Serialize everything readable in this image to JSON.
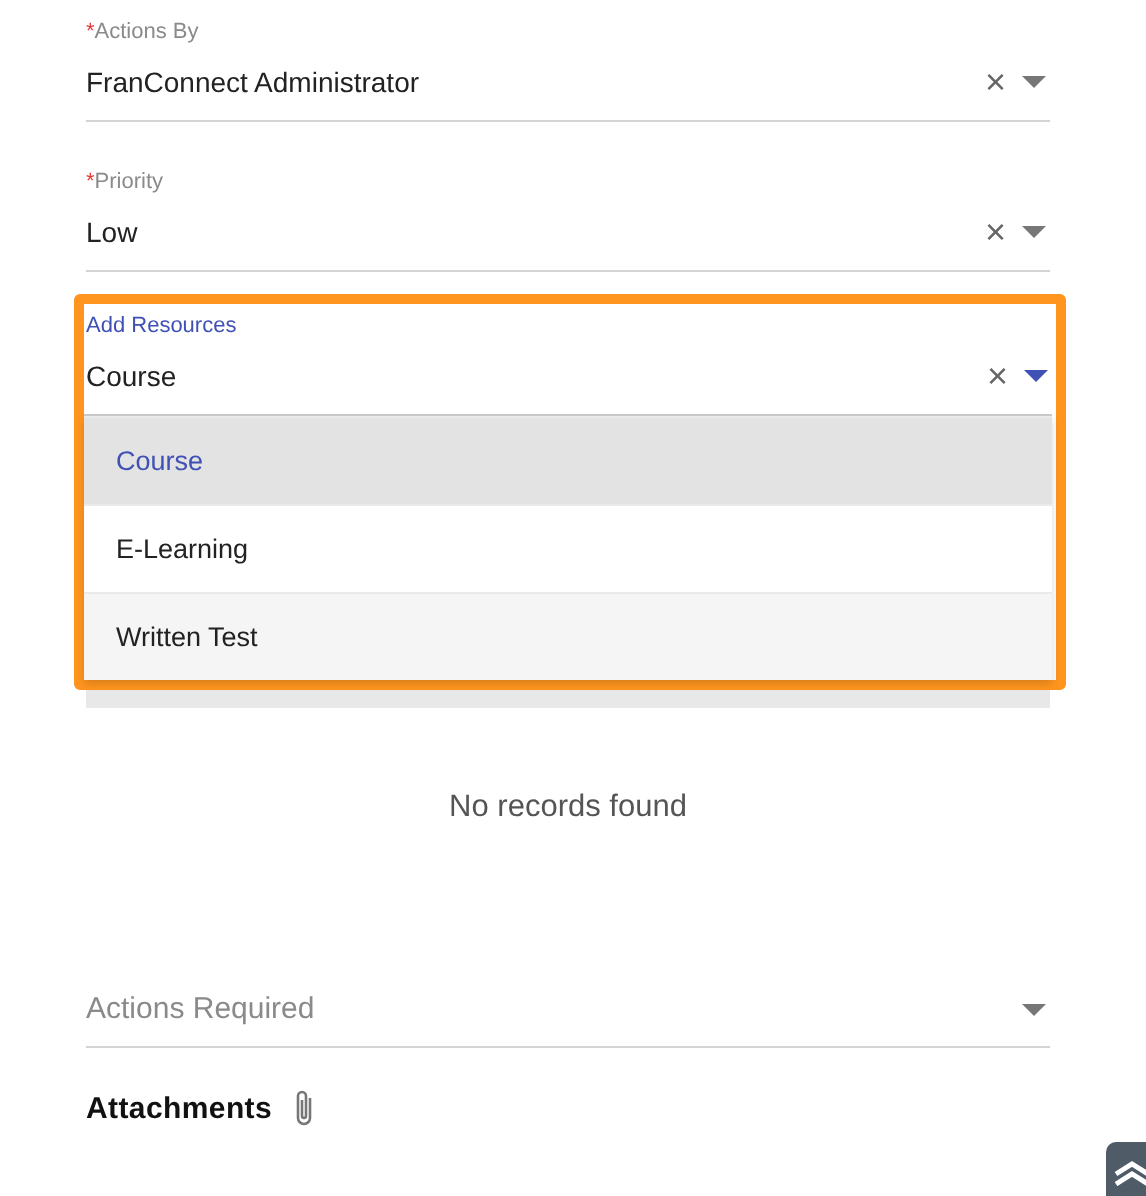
{
  "fields": [
    {
      "label": "Actions By",
      "required": true,
      "focused": false,
      "value": "FranConnect Administrator",
      "clearable": true
    },
    {
      "label": "Priority",
      "required": true,
      "focused": false,
      "value": "Low",
      "clearable": true
    },
    {
      "label": "Add Resources",
      "required": false,
      "focused": true,
      "value": "Course",
      "clearable": true
    }
  ],
  "clear_glyph": "×",
  "required_mark": "*",
  "dropdown": {
    "options": [
      {
        "label": "Course",
        "selected": true
      },
      {
        "label": "E-Learning",
        "selected": false
      },
      {
        "label": "Written Test",
        "selected": false
      }
    ]
  },
  "empty_message": "No records found",
  "actions_required": {
    "placeholder": "Actions Required"
  },
  "attachments": {
    "label": "Attachments"
  }
}
